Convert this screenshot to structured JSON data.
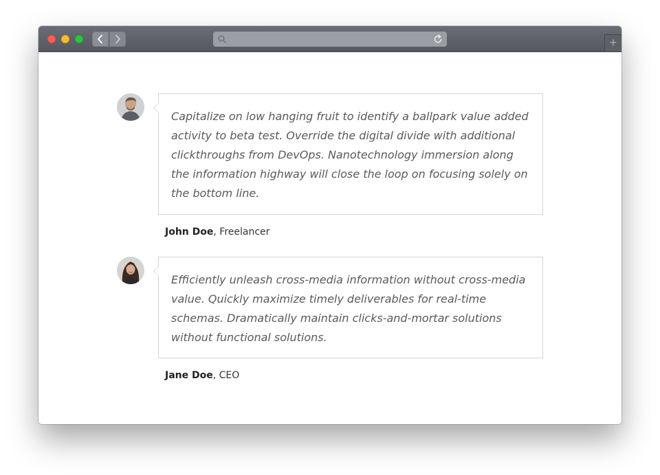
{
  "browser": {
    "controls": {
      "close": "close-button",
      "minimize": "minimize-button",
      "zoom": "zoom-button"
    },
    "nav": {
      "back_icon": "chevron-left-icon",
      "forward_icon": "chevron-right-icon"
    },
    "address_bar": {
      "value": "",
      "search_icon": "search-icon",
      "reload_icon": "reload-icon"
    },
    "new_tab_label": "+"
  },
  "testimonials": [
    {
      "quote": "Capitalize on low hanging fruit to identify a ballpark value added activity to beta test. Override the digital divide with additional clickthroughs from DevOps. Nanotechnology immersion along the information highway will close the loop on focusing solely on the bottom line.",
      "name": "John Doe",
      "separator": ", ",
      "role": "Freelancer"
    },
    {
      "quote": "Efficiently unleash cross-media information without cross-media value. Quickly maximize timely deliverables for real-time schemas. Dramatically maintain clicks-and-mortar solutions without functional solutions.",
      "name": "Jane Doe",
      "separator": ", ",
      "role": "CEO"
    }
  ],
  "colors": {
    "titlebar": "#5f6269",
    "bubble_border": "#d4d4d4",
    "quote_text": "#5a5a5a",
    "author_text": "#222222"
  }
}
